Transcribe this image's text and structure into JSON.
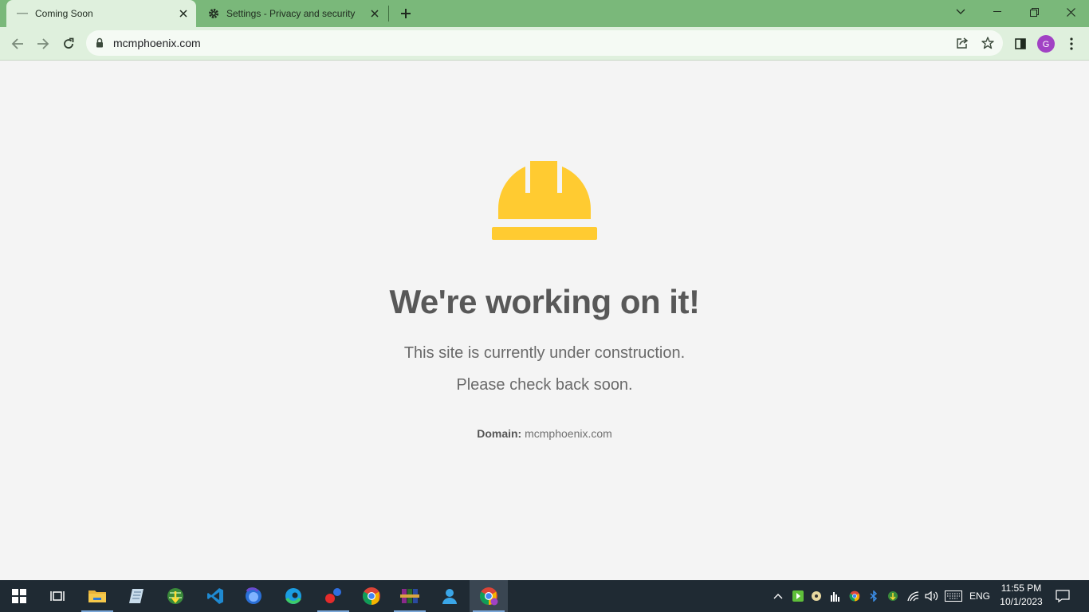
{
  "browser": {
    "tabs": [
      {
        "title": "Coming Soon",
        "active": true
      },
      {
        "title": "Settings - Privacy and security",
        "active": false
      }
    ],
    "url": "mcmphoenix.com",
    "profile_initial": "G"
  },
  "page": {
    "heading": "We're working on it!",
    "line1": "This site is currently under construction.",
    "line2": "Please check back soon.",
    "domain_label": "Domain:",
    "domain_value": "mcmphoenix.com",
    "helmet_color": "#ffcb31"
  },
  "taskbar": {
    "apps": [
      "start-icon",
      "task-view-icon",
      "file-explorer-icon",
      "notepad-icon",
      "internet-download-manager-icon",
      "vscode-icon",
      "firefox-icon",
      "edge-icon",
      "dot-app-icon",
      "chrome-icon",
      "winrar-icon",
      "user-folder-icon",
      "chrome-profile-icon"
    ],
    "language": "ENG",
    "time": "11:55 PM",
    "date": "10/1/2023"
  },
  "colors": {
    "titlebar": "#7ab87a",
    "toolbar": "#dff0dd",
    "taskbar": "#1f2a33"
  }
}
